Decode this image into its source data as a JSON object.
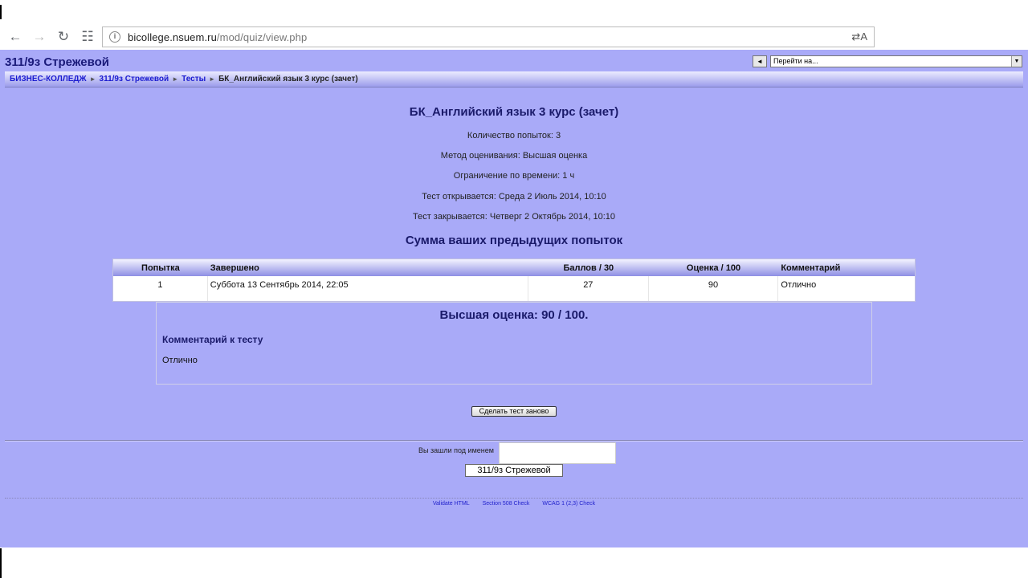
{
  "browser": {
    "url_host": "bicollege.nsuem.ru",
    "url_path": "/mod/quiz/view.php"
  },
  "header": {
    "course_title": "311/9з Стрежевой",
    "jump_prev_label": "◄",
    "jump_placeholder": "Перейти на..."
  },
  "breadcrumb": {
    "items": [
      "БИЗНЕС-КОЛЛЕДЖ",
      "311/9з Стрежевой",
      "Тесты"
    ],
    "current": "БК_Английский язык 3 курс (зачет)",
    "separator": "►"
  },
  "quiz": {
    "title": "БК_Английский язык 3 курс (зачет)",
    "info": [
      "Количество попыток: 3",
      "Метод оценивания: Высшая оценка",
      "Ограничение по времени: 1 ч",
      "Тест открывается: Среда 2 Июль 2014, 10:10",
      "Тест закрывается: Четверг 2 Октябрь 2014, 10:10"
    ]
  },
  "summary": {
    "title": "Сумма ваших предыдущих попыток",
    "columns": [
      "Попытка",
      "Завершено",
      "Баллов / 30",
      "Оценка / 100",
      "Комментарий"
    ],
    "rows": [
      [
        "1",
        "Суббота 13 Сентябрь 2014, 22:05",
        "27",
        "90",
        "Отлично"
      ]
    ]
  },
  "result": {
    "best_grade": "Высшая оценка: 90 / 100.",
    "feedback_title": "Комментарий к тесту",
    "feedback_text": "Отлично"
  },
  "actions": {
    "retake_label": "Сделать тест заново"
  },
  "footer": {
    "logged_in_label": "Вы зашли под именем",
    "user_name": "311/9з Стрежевой",
    "links": [
      "Validate HTML",
      "Section 508 Check",
      "WCAG 1 (2,3) Check"
    ]
  }
}
